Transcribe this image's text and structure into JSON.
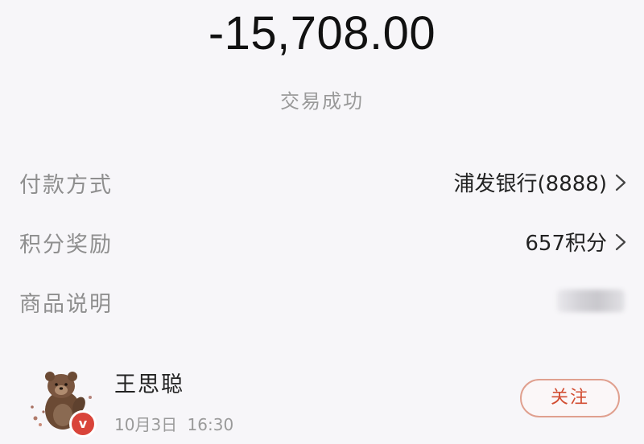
{
  "transaction": {
    "amount": "-15,708.00",
    "status": "交易成功"
  },
  "details": [
    {
      "label": "付款方式",
      "value": "浦发银行(8888)",
      "chevron": true
    },
    {
      "label": "积分奖励",
      "value": "657积分",
      "chevron": true
    },
    {
      "label": "商品说明",
      "value": "",
      "chevron": false
    }
  ],
  "merchant": {
    "name": "王思聪",
    "time": "10月3日 16:30",
    "follow_label": "关注",
    "verified_badge": "v",
    "avatar_icon": "bear-avatar-icon"
  },
  "colors": {
    "background": "#f7f6f9",
    "label_gray": "#8f8f8f",
    "accent_red": "#d24e33",
    "badge_red": "#d9443a"
  }
}
